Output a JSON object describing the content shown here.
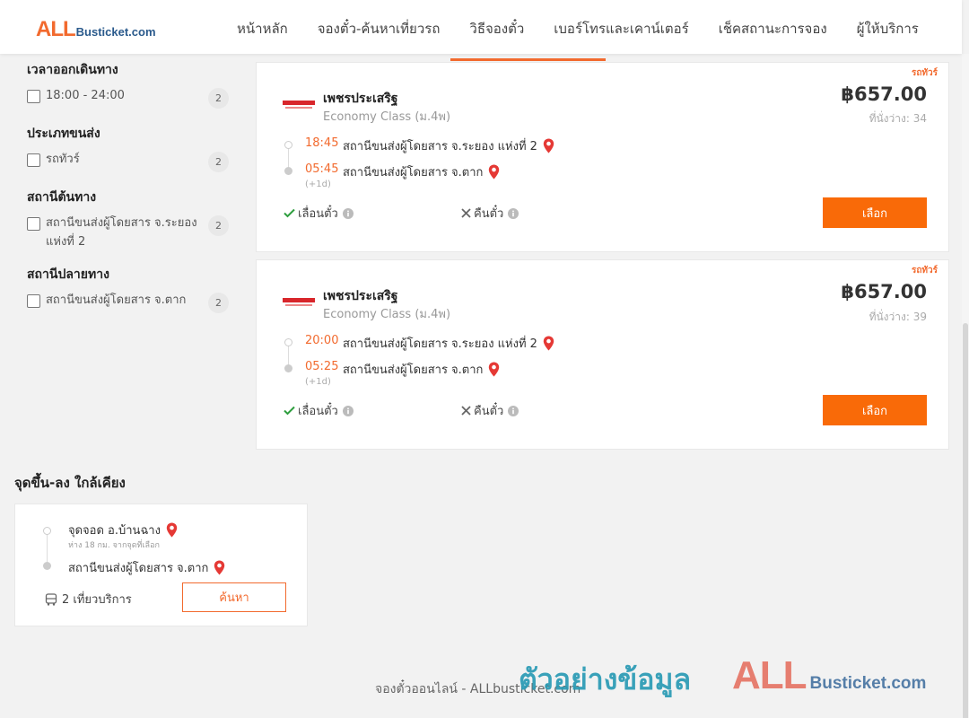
{
  "header": {
    "logo_all": "ALL",
    "logo_rest": "Busticket.com",
    "nav": [
      "หน้าหลัก",
      "จองตั๋ว-ค้นหาเที่ยวรถ",
      "วิธีจองตั๋ว",
      "เบอร์โทรและเคาน์เตอร์",
      "เช็คสถานะการจอง",
      "ผู้ให้บริการ"
    ]
  },
  "filters": {
    "departure_time": {
      "title": "เวลาออกเดินทาง",
      "label": "18:00 - 24:00",
      "count": "2"
    },
    "transport_type": {
      "title": "ประเภทขนส่ง",
      "label": "รถทัวร์",
      "count": "2"
    },
    "origin": {
      "title": "สถานีต้นทาง",
      "label": "สถานีขนส่งผู้โดยสาร จ.ระยอง แห่งที่ 2",
      "count": "2"
    },
    "destination": {
      "title": "สถานีปลายทาง",
      "label": "สถานีขนส่งผู้โดยสาร จ.ตาก",
      "count": "2"
    }
  },
  "trips": [
    {
      "tag": "รถทัวร์",
      "operator": "เพชรประเสริฐ",
      "class": "Economy Class (ม.4พ)",
      "price": "฿657.00",
      "seats": "ที่นั่งว่าง: 34",
      "depart_time": "18:45",
      "depart_station": "สถานีขนส่งผู้โดยสาร จ.ระยอง แห่งที่ 2",
      "arrive_time": "05:45",
      "arrive_station": "สถานีขนส่งผู้โดยสาร จ.ตาก",
      "next_day": "(+1d)",
      "feature_yes": "เลื่อนตั๋ว",
      "feature_no": "คืนตั๋ว",
      "button": "เลือก"
    },
    {
      "tag": "รถทัวร์",
      "operator": "เพชรประเสริฐ",
      "class": "Economy Class (ม.4พ)",
      "price": "฿657.00",
      "seats": "ที่นั่งว่าง: 39",
      "depart_time": "20:00",
      "depart_station": "สถานีขนส่งผู้โดยสาร จ.ระยอง แห่งที่ 2",
      "arrive_time": "05:25",
      "arrive_station": "สถานีขนส่งผู้โดยสาร จ.ตาก",
      "next_day": "(+1d)",
      "feature_yes": "เลื่อนตั๋ว",
      "feature_no": "คืนตั๋ว",
      "button": "เลือก"
    }
  ],
  "nearby": {
    "title": "จุดขึ้น-ลง ใกล้เคียง",
    "stop1": "จุดจอด อ.บ้านฉาง",
    "stop1_distance": "ห่าง 18 กม. จากจุดที่เลือก",
    "stop2": "สถานีขนส่งผู้โดยสาร จ.ตาก",
    "trips": "2 เที่ยวบริการ",
    "button": "ค้นหา"
  },
  "footer": {
    "text": "จองตั๋วออนไลน์ - ALLbusticket.com",
    "watermark_text": "ตัวอย่างข้อมูล",
    "watermark_all": "ALL",
    "watermark_rest": "Busticket.com"
  },
  "colors": {
    "accent": "#f26a2e",
    "button": "#f96a08",
    "watermark": "#2a9bb5"
  }
}
